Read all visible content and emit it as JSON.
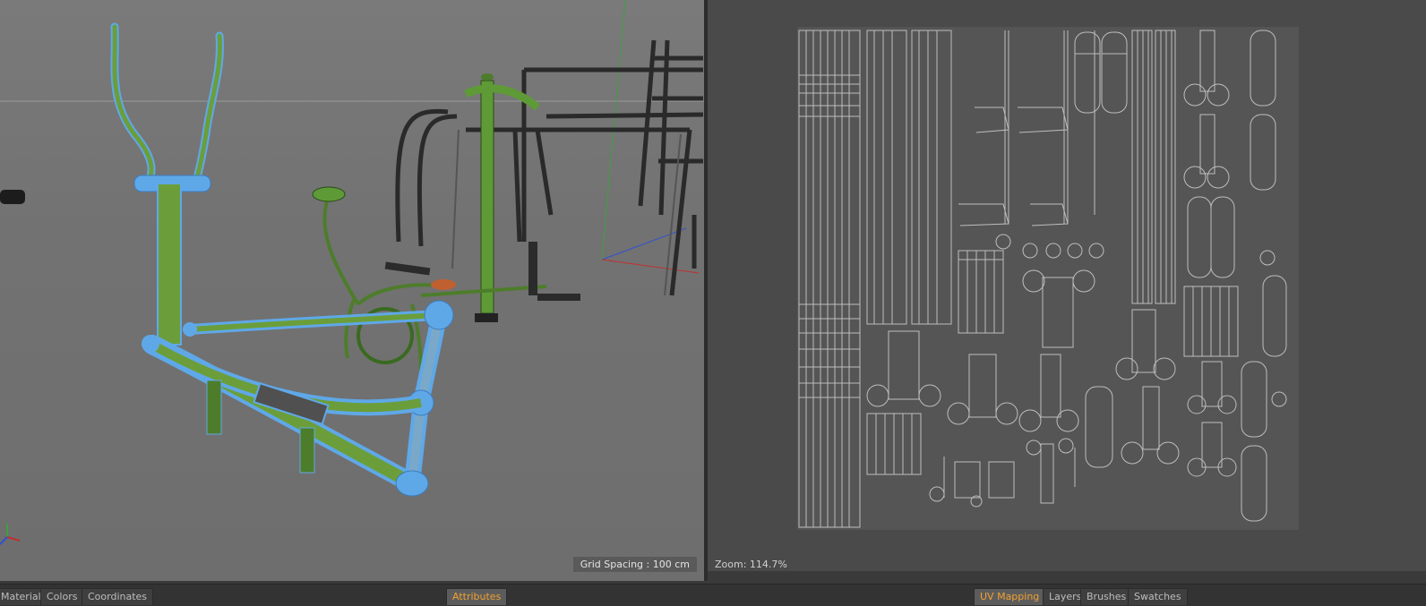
{
  "viewport": {
    "grid_spacing": "Grid Spacing : 100 cm"
  },
  "uv_editor": {
    "zoom": "Zoom: 114.7%"
  },
  "tabs_left": [
    {
      "label": "Materials"
    },
    {
      "label": "Colors"
    },
    {
      "label": "Coordinates"
    }
  ],
  "tab_center": {
    "label": "Attributes"
  },
  "tabs_right": [
    {
      "label": "UV Mapping"
    },
    {
      "label": "Layers"
    },
    {
      "label": "Brushes"
    },
    {
      "label": "Swatches"
    }
  ],
  "colors": {
    "selection_blue": "#5fa8e8",
    "mesh_green": "#4e8a2e",
    "active_tab_orange": "#f0a030"
  }
}
